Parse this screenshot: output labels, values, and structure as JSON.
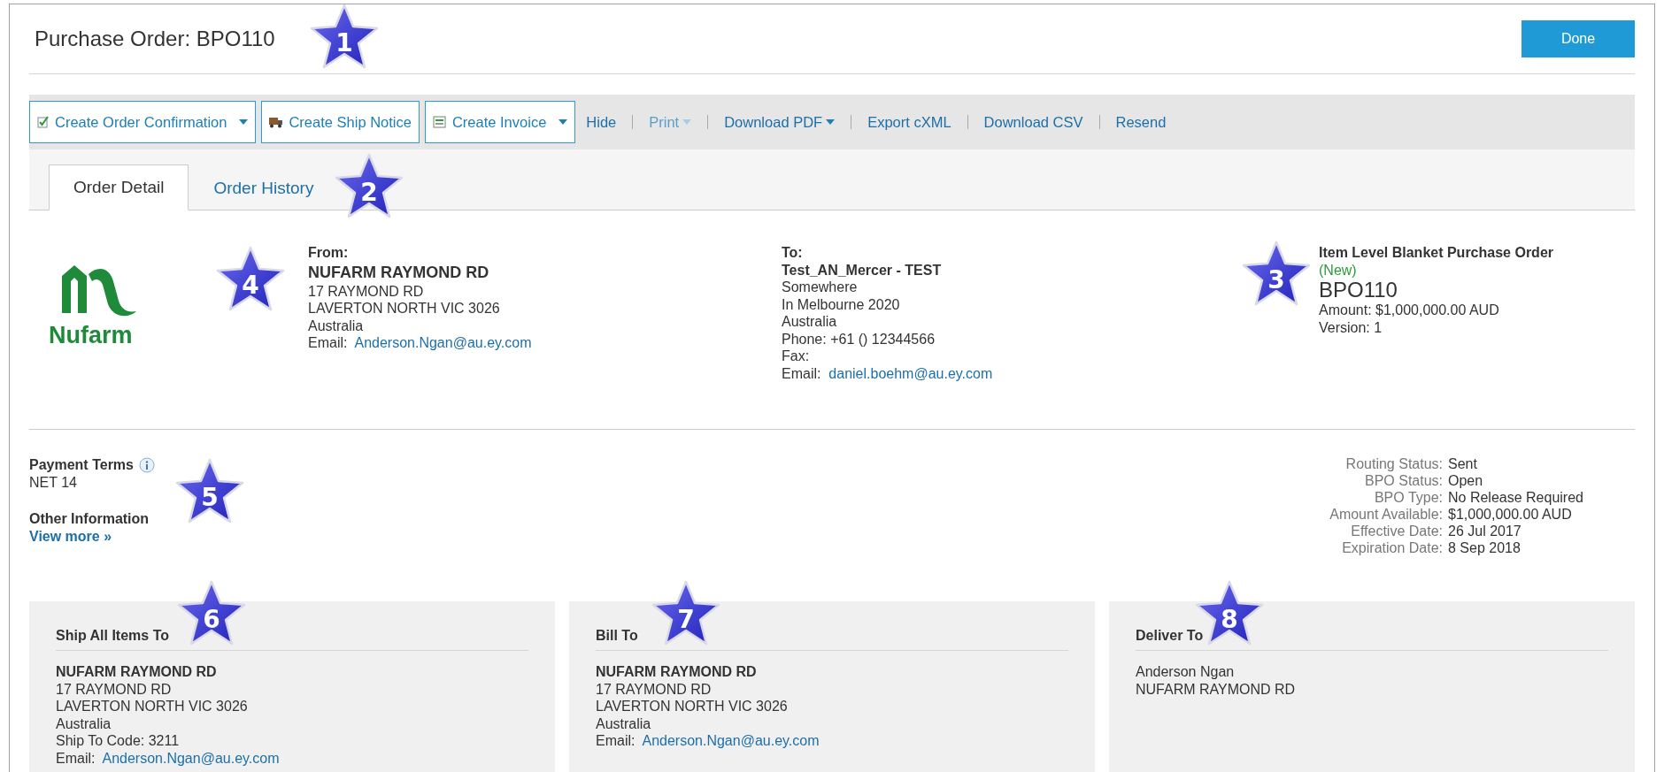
{
  "header": {
    "title": "Purchase Order: BPO110",
    "done_button": "Done"
  },
  "toolbar": [
    {
      "kind": "button",
      "label": "Create Order Confirmation",
      "dropdown": true
    },
    {
      "kind": "button",
      "label": "Create Ship Notice",
      "dropdown": false
    },
    {
      "kind": "button",
      "label": "Create Invoice",
      "dropdown": true
    },
    {
      "kind": "link",
      "label": "Hide",
      "dropdown": false,
      "disabled": false
    },
    {
      "kind": "link",
      "label": "Print",
      "dropdown": true,
      "disabled": true
    },
    {
      "kind": "link",
      "label": "Download PDF",
      "dropdown": true,
      "disabled": false
    },
    {
      "kind": "link",
      "label": "Export cXML",
      "dropdown": false,
      "disabled": false
    },
    {
      "kind": "link",
      "label": "Download CSV",
      "dropdown": false,
      "disabled": false
    },
    {
      "kind": "link",
      "label": "Resend",
      "dropdown": false,
      "disabled": false
    }
  ],
  "tabs": [
    {
      "label": "Order Detail",
      "selected": true
    },
    {
      "label": "Order History",
      "selected": false
    }
  ],
  "logo": {
    "text": "Nufarm"
  },
  "from": {
    "heading": "From:",
    "name": "NUFARM RAYMOND RD",
    "lines": [
      "17 RAYMOND RD",
      "LAVERTON NORTH VIC 3026",
      "Australia"
    ],
    "email_label": "Email:",
    "email": "Anderson.Ngan@au.ey.com"
  },
  "to": {
    "heading": "To:",
    "name": "Test_AN_Mercer - TEST",
    "lines": [
      "Somewhere",
      "In Melbourne 2020",
      "Australia",
      "Phone: +61 () 12344566",
      "Fax:"
    ],
    "email_label": "Email:",
    "email": "daniel.boehm@au.ey.com"
  },
  "order": {
    "type": "Item Level Blanket Purchase Order",
    "status": "(New)",
    "number": "BPO110",
    "amount": "Amount: $1,000,000.00 AUD",
    "version": "Version: 1"
  },
  "payment_terms": {
    "label": "Payment Terms",
    "value": "NET 14"
  },
  "other_information": {
    "label": "Other Information",
    "link": "View more »"
  },
  "status_fields": [
    {
      "label": "Routing Status:",
      "value": "Sent"
    },
    {
      "label": "BPO Status:",
      "value": "Open"
    },
    {
      "label": "BPO Type:",
      "value": "No Release Required"
    },
    {
      "label": "Amount Available:",
      "value": "$1,000,000.00 AUD"
    },
    {
      "label": "Effective Date:",
      "value": "26 Jul 2017"
    },
    {
      "label": "Expiration Date:",
      "value": "8 Sep 2018"
    }
  ],
  "address_panels": [
    {
      "title": "Ship All Items To",
      "name": "NUFARM RAYMOND RD",
      "lines": [
        "17 RAYMOND RD",
        "LAVERTON NORTH VIC 3026",
        "Australia",
        "Ship To Code:  3211"
      ],
      "email_label": "Email:",
      "email": "Anderson.Ngan@au.ey.com"
    },
    {
      "title": "Bill To",
      "name": "NUFARM RAYMOND RD",
      "lines": [
        "17 RAYMOND RD",
        "LAVERTON NORTH VIC 3026",
        "Australia"
      ],
      "email_label": "Email:",
      "email": "Anderson.Ngan@au.ey.com"
    },
    {
      "title": "Deliver To",
      "lines": [
        "Anderson Ngan",
        "NUFARM RAYMOND RD"
      ]
    }
  ],
  "callouts": [
    {
      "label": "1"
    },
    {
      "label": "2"
    },
    {
      "label": "3"
    },
    {
      "label": "4"
    },
    {
      "label": "5"
    },
    {
      "label": "6"
    },
    {
      "label": "7"
    },
    {
      "label": "8"
    }
  ]
}
